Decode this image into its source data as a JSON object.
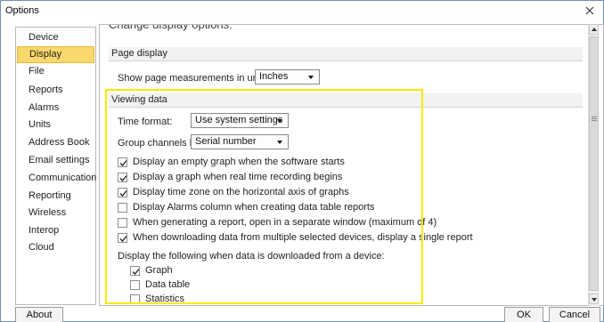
{
  "window": {
    "title": "Options"
  },
  "sidebar": {
    "items": [
      {
        "label": "Device",
        "active": false
      },
      {
        "label": "Display",
        "active": true
      },
      {
        "label": "File",
        "active": false
      },
      {
        "label": "Reports",
        "active": false
      },
      {
        "label": "Alarms",
        "active": false
      },
      {
        "label": "Units",
        "active": false
      },
      {
        "label": "Address Book",
        "active": false
      },
      {
        "label": "Email settings",
        "active": false
      },
      {
        "label": "Communication",
        "active": false
      },
      {
        "label": "Reporting",
        "active": false
      },
      {
        "label": "Wireless",
        "active": false
      },
      {
        "label": "Interop",
        "active": false
      },
      {
        "label": "Cloud",
        "active": false
      }
    ]
  },
  "content": {
    "cut_heading": "Change display options:",
    "page_display": {
      "header": "Page display",
      "units_label": "Show page measurements in units of:",
      "units_value": "Inches"
    },
    "viewing_data": {
      "header": "Viewing data",
      "time_format_label": "Time format:",
      "time_format_value": "Use system settings",
      "group_by_label": "Group channels by:",
      "group_by_value": "Serial number",
      "checkboxes": [
        {
          "label": "Display an empty graph when the software starts",
          "checked": true
        },
        {
          "label": "Display a graph when real time recording begins",
          "checked": true
        },
        {
          "label": "Display time zone on the horizontal axis of graphs",
          "checked": true
        },
        {
          "label": "Display Alarms column when creating data table reports",
          "checked": false
        },
        {
          "label": "When generating a report, open in a separate window (maximum of 4)",
          "checked": false
        },
        {
          "label": "When downloading data from multiple selected devices, display a single report",
          "checked": true
        }
      ],
      "download_label": "Display the following when data is downloaded from a device:",
      "download_options": [
        {
          "label": "Graph",
          "checked": true
        },
        {
          "label": "Data table",
          "checked": false
        },
        {
          "label": "Statistics",
          "checked": false
        }
      ]
    }
  },
  "footer": {
    "about_label": "About",
    "ok_label": "OK",
    "cancel_label": "Cancel"
  },
  "colors": {
    "active_item_bg": "#fbd86b",
    "highlight_border": "#ffe800",
    "section_bg": "#f2f2f2"
  }
}
